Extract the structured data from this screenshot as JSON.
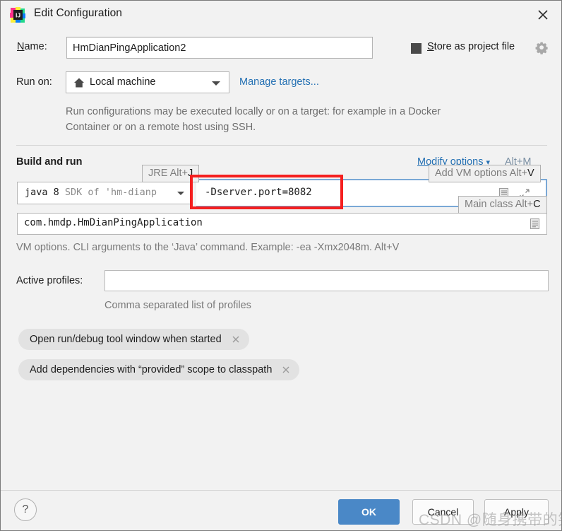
{
  "window": {
    "title": "Edit Configuration",
    "logo_icon": "intellij-idea-logo",
    "close_icon": "close-icon"
  },
  "name_row": {
    "label_pre": "N",
    "label_mnemonic": "N",
    "label": "Name:",
    "value": "HmDianPingApplication2",
    "placeholder": ""
  },
  "store_as_project_file": {
    "label": "Store as project file",
    "checked": true,
    "gear_icon": "gear-dropdown-icon"
  },
  "run_on": {
    "label": "Run on:",
    "value": "Local machine",
    "icon": "home-icon",
    "manage_link": "Manage targets...",
    "description": "Run configurations may be executed locally or on a target: for example in a Docker Container or on a remote host using SSH."
  },
  "build_and_run": {
    "section_title": "Build and run",
    "modify_options_label": "Modify options",
    "modify_options_chevron": "⌄",
    "modify_options_shortcut": "Alt+M",
    "jre": {
      "value_dark": "java 8",
      "value_gray": "SDK of 'hm-dianp",
      "tooltip": "JRE Alt+J",
      "tooltip_plain": "JRE Alt+",
      "tooltip_mnemonic": "J"
    },
    "vm_options": {
      "value": "-Dserver.port=8082",
      "tooltip_plain": "Add VM options Alt+",
      "tooltip_mnemonic": "V",
      "doc_icon": "document-icon",
      "expand_icon": "expand-diagonal-icon"
    },
    "main_class": {
      "value": "com.hmdp.HmDianPingApplication",
      "tooltip_plain": "Main class Alt+",
      "tooltip_mnemonic": "C",
      "doc_icon": "document-icon"
    },
    "vm_hint": "VM options. CLI arguments to the ‘Java’ command. Example: -ea -Xmx2048m. Alt+V"
  },
  "active_profiles": {
    "label": "Active profiles:",
    "value": "",
    "hint": "Comma separated list of profiles"
  },
  "chips": [
    {
      "label": "Open run/debug tool window when started",
      "remove_icon": "close-small-icon"
    },
    {
      "label": "Add dependencies with “provided” scope to classpath",
      "remove_icon": "close-small-icon"
    }
  ],
  "footer": {
    "help_label": "?",
    "ok_label": "OK",
    "cancel_label": "Cancel",
    "apply_label": "Apply"
  },
  "annotation": {
    "highlight_color": "#f51f1f"
  },
  "watermark": {
    "text": "CSDN @随身携带的笑"
  },
  "colors": {
    "dialog_bg": "#f2f2f2",
    "accent_blue": "#4a88c7",
    "link_blue": "#2470b3",
    "focus_border": "#7aa8d6",
    "hint_gray": "#7a7a7a"
  }
}
